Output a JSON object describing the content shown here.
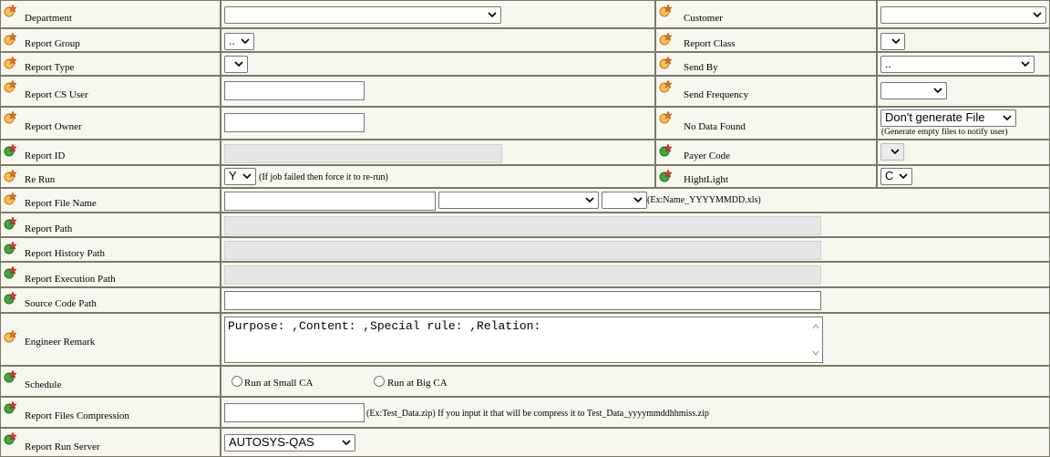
{
  "colors": {
    "background": "#F7F6EF",
    "border": "#7A7A66",
    "required_icon": "orange-star",
    "optional_icon": "green-star"
  },
  "icons": {
    "required": "orange-star-icon",
    "optional": "green-star-icon",
    "dropdown": "chevron-down-icon"
  },
  "department": {
    "label": "Department",
    "value": ""
  },
  "customer": {
    "label": "Customer",
    "value": ""
  },
  "report_group": {
    "label": "Report Group",
    "value": ".."
  },
  "report_class": {
    "label": "Report Class",
    "value": ""
  },
  "report_type": {
    "label": "Report Type",
    "value": ""
  },
  "send_by": {
    "label": "Send By",
    "value": ".."
  },
  "report_cs_user": {
    "label": "Report CS User",
    "value": ""
  },
  "send_frequency": {
    "label": "Send Frequency",
    "value": ""
  },
  "report_owner": {
    "label": "Report Owner",
    "value": ""
  },
  "no_data_found": {
    "label": "No Data Found",
    "value": "Don't generate File",
    "hint": "(Generate empty files to notify user)"
  },
  "report_id": {
    "label": "Report ID",
    "value": ""
  },
  "payer_code": {
    "label": "Payer Code",
    "value": ""
  },
  "re_run": {
    "label": "Re Run",
    "value": "Y",
    "hint": "(If job failed then force it to re-run)"
  },
  "highlight": {
    "label": "HightLight",
    "value": "C"
  },
  "report_file_name": {
    "label": "Report File Name",
    "value": "",
    "select1": "",
    "select2": "",
    "hint": "(Ex:Name_YYYYMMDD.xls)"
  },
  "report_path": {
    "label": "Report Path",
    "value": ""
  },
  "report_history_path": {
    "label": "Report History Path",
    "value": ""
  },
  "report_execution_path": {
    "label": "Report Execution Path",
    "value": ""
  },
  "source_code_path": {
    "label": "Source Code Path",
    "value": ""
  },
  "engineer_remark": {
    "label": "Engineer Remark",
    "value": "Purpose: ,Content: ,Special rule: ,Relation:"
  },
  "schedule": {
    "label": "Schedule",
    "option1": "Run at Small CA",
    "option2": "Run at Big CA"
  },
  "compression": {
    "label": "Report Files Compression",
    "value": "",
    "hint": "(Ex:Test_Data.zip) If you input it that will be compress it to Test_Data_yyyymmddhhmiss.zip"
  },
  "run_server": {
    "label": "Report Run Server",
    "value": "AUTOSYS-QAS"
  }
}
